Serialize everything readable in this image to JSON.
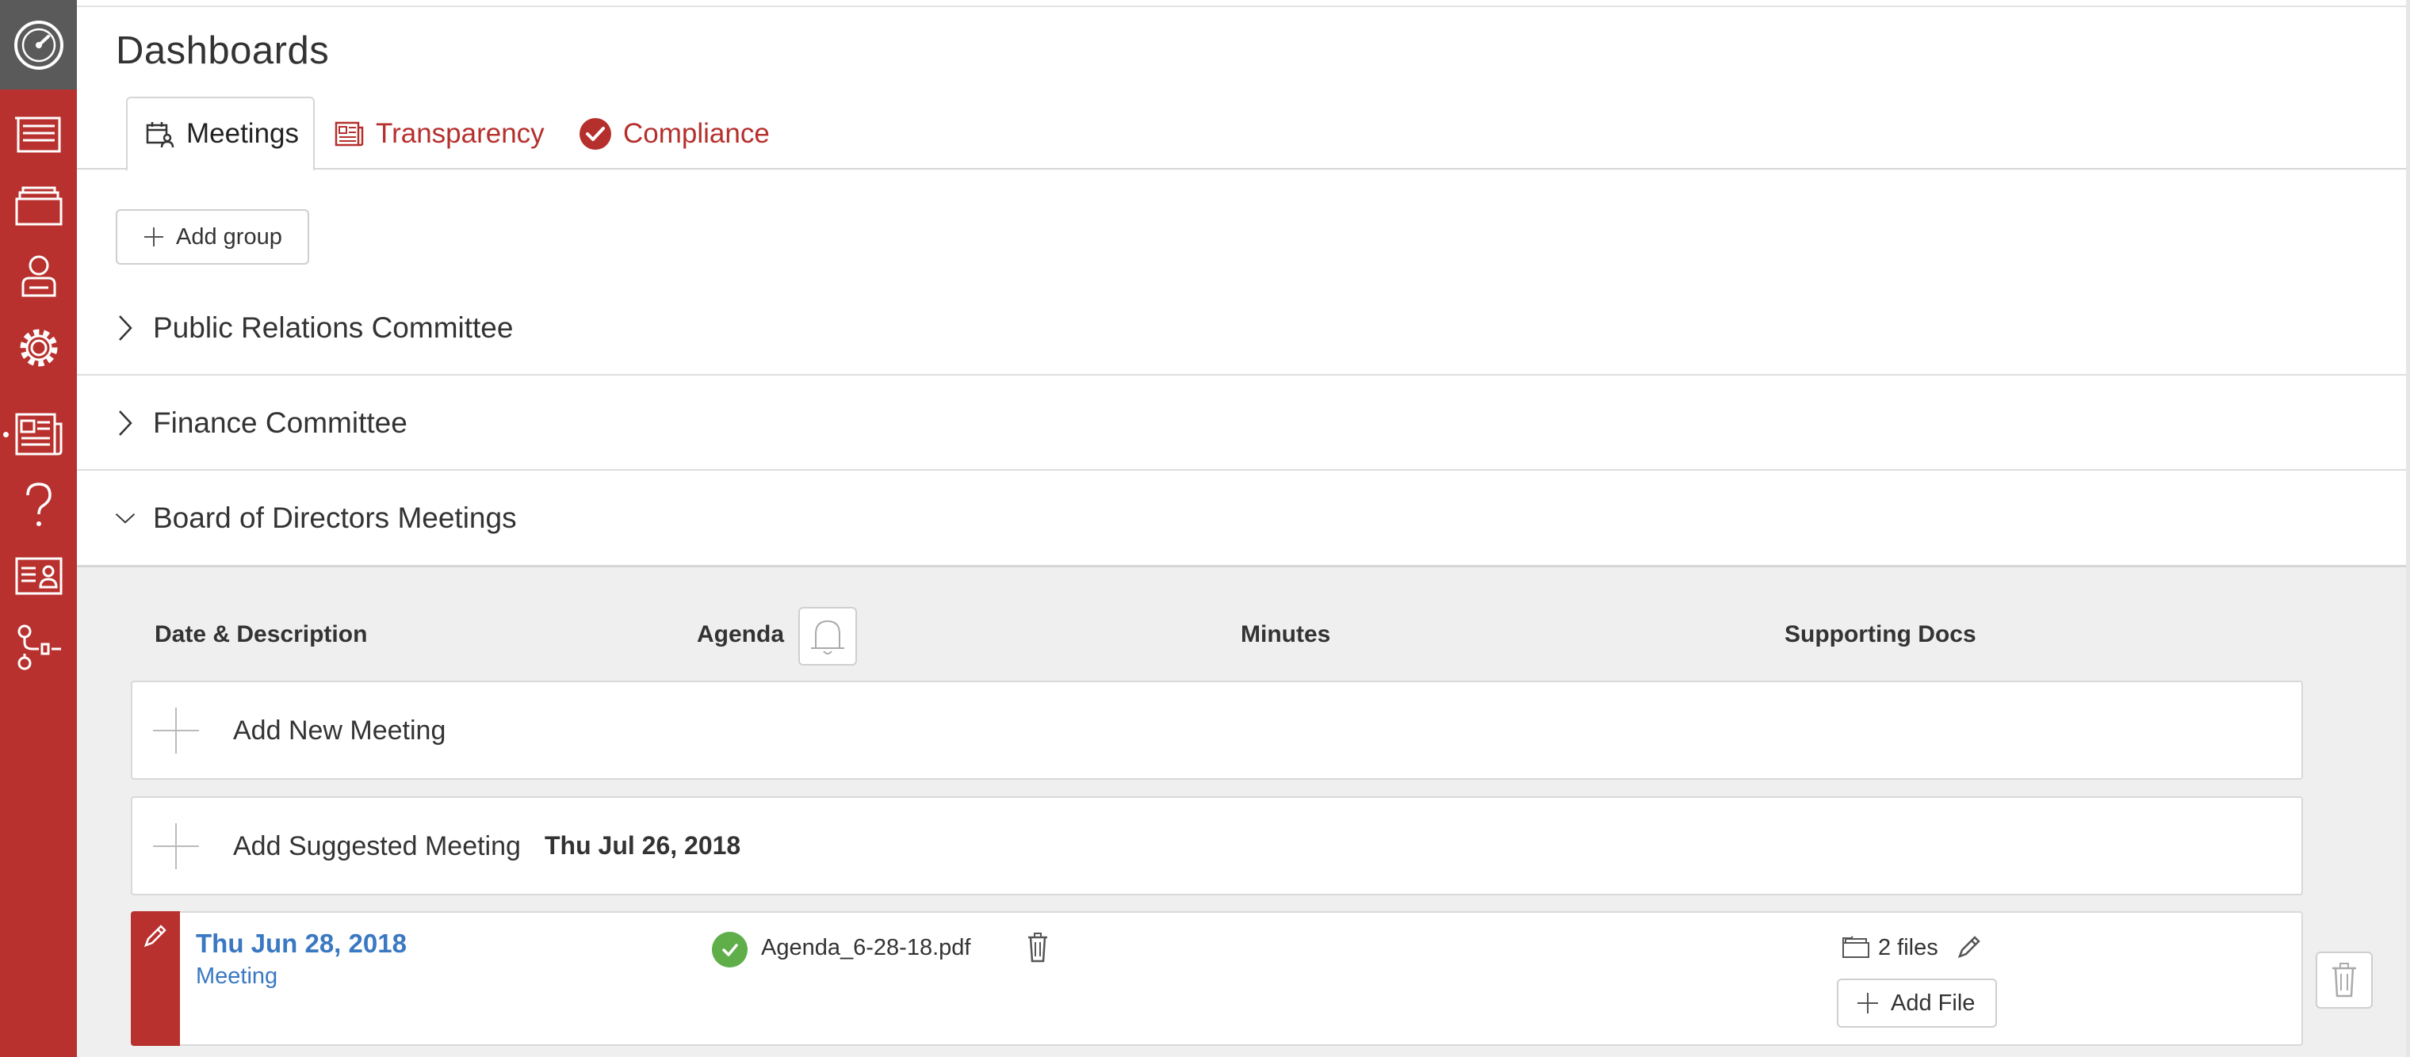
{
  "page": {
    "title": "Dashboards"
  },
  "sidebar": {
    "items": [
      {
        "icon": "dashboard-gauge-icon"
      },
      {
        "icon": "list-icon"
      },
      {
        "icon": "folders-icon"
      },
      {
        "icon": "user-icon"
      },
      {
        "icon": "gear-icon"
      },
      {
        "icon": "newspaper-icon"
      },
      {
        "icon": "question-icon"
      },
      {
        "icon": "contact-card-icon"
      },
      {
        "icon": "workflow-icon"
      }
    ]
  },
  "tabs": [
    {
      "label": "Meetings",
      "icon": "meetings-icon",
      "active": true
    },
    {
      "label": "Transparency",
      "icon": "newspaper-icon",
      "active": false
    },
    {
      "label": "Compliance",
      "icon": "check-circle-icon",
      "active": false
    }
  ],
  "toolbar": {
    "add_group_label": "Add group"
  },
  "groups": [
    {
      "label": "Public Relations Committee",
      "expanded": false
    },
    {
      "label": "Finance Committee",
      "expanded": false
    },
    {
      "label": "Board of Directors Meetings",
      "expanded": true
    }
  ],
  "meetings_table": {
    "columns": [
      "Date & Description",
      "Agenda",
      "Minutes",
      "Supporting Docs"
    ],
    "add_new_label": "Add New Meeting",
    "add_suggested_label": "Add Suggested Meeting",
    "suggested_date": "Thu Jul 26, 2018",
    "rows": [
      {
        "date": "Thu Jun 28, 2018",
        "type": "Meeting",
        "agenda_file": "Agenda_6-28-18.pdf",
        "docs_count": "2 files",
        "add_file_label": "Add File"
      }
    ]
  },
  "colors": {
    "brand_red": "#b8312e",
    "link_blue": "#3a78c2",
    "success_green": "#5fae4a"
  }
}
